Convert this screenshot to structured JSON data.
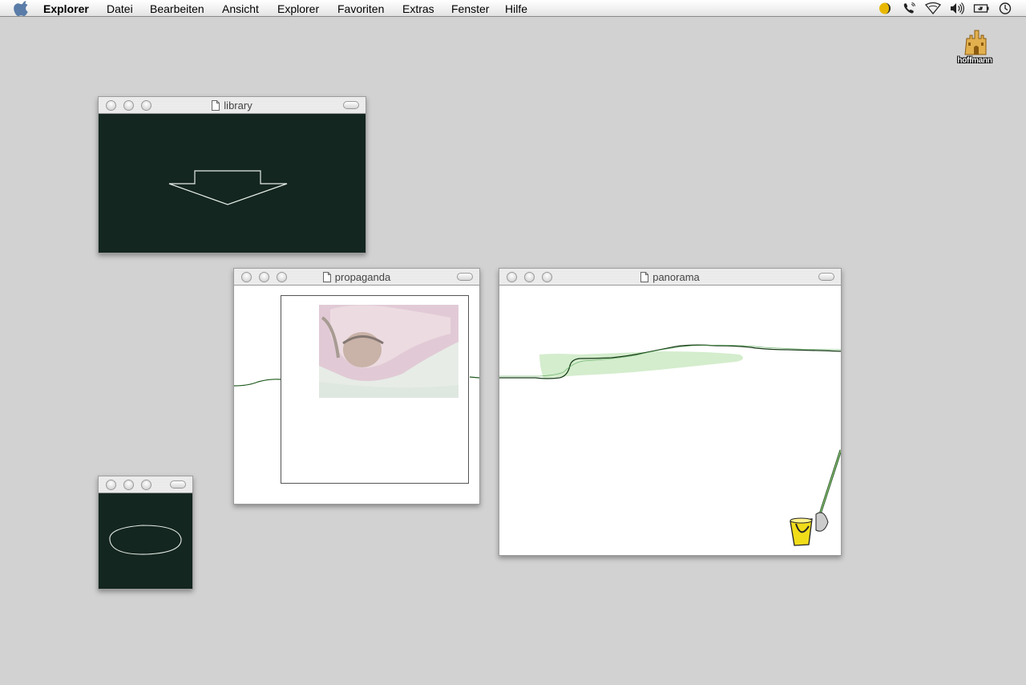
{
  "menubar": {
    "app_name": "Explorer",
    "items": [
      "Datei",
      "Bearbeiten",
      "Ansicht",
      "Explorer",
      "Favoriten",
      "Extras",
      "Fenster",
      "Hilfe"
    ],
    "tray_icons": [
      "moon-status-icon",
      "phone-icon",
      "airport-icon",
      "volume-icon",
      "battery-icon",
      "clock-icon"
    ]
  },
  "desktop": {
    "disk_label": "hoffmann"
  },
  "windows": {
    "library": {
      "title": "library"
    },
    "propaganda": {
      "title": "propaganda"
    },
    "panorama": {
      "title": "panorama"
    },
    "small": {
      "title": ""
    }
  }
}
